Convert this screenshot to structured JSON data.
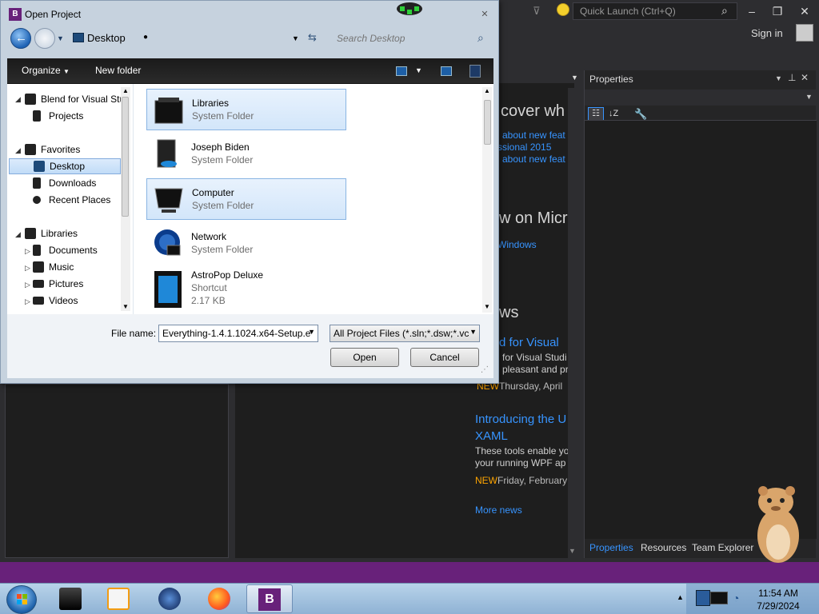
{
  "ide": {
    "quick_launch_placeholder": "Quick Launch (Ctrl+Q)",
    "sign_in": "Sign in",
    "start_page": {
      "heading_discover": "cover wh",
      "link1": "about new feat",
      "link2": "ssional 2015",
      "link3": "about new feat",
      "heading_new_on": "w on Micro",
      "windows_link": "Windows",
      "heading_news": "ws",
      "news1_title": "d for Visual",
      "news1_line1": "for Visual Studi",
      "news1_line2": "pleasant and pr",
      "news1_new": "NEW",
      "news1_date": "Thursday, April",
      "news2_title1": "Introducing the U",
      "news2_title2": "XAML",
      "news2_body1": "These tools enable yo",
      "news2_body2": "your running WPF ap",
      "news2_new": "NEW",
      "news2_date": "Friday, February",
      "more_news": "More news"
    },
    "properties": {
      "title": "Properties",
      "tabs": [
        "Properties",
        "Resources",
        "Team Explorer"
      ]
    },
    "accent_color": "#68217a"
  },
  "dialog": {
    "title": "Open Project",
    "address": "Desktop",
    "search_placeholder": "Search Desktop",
    "commands": {
      "organize": "Organize",
      "new_folder": "New folder"
    },
    "nav_tree": [
      {
        "label": "Blend for Visual Stu",
        "level": 0,
        "expanded": true
      },
      {
        "label": "Projects",
        "level": 1
      },
      {
        "label": "Favorites",
        "level": 0,
        "expanded": true
      },
      {
        "label": "Desktop",
        "level": 1,
        "selected": true
      },
      {
        "label": "Downloads",
        "level": 1
      },
      {
        "label": "Recent Places",
        "level": 1
      },
      {
        "label": "Libraries",
        "level": 0,
        "expanded": true
      },
      {
        "label": "Documents",
        "level": 1
      },
      {
        "label": "Music",
        "level": 1
      },
      {
        "label": "Pictures",
        "level": 1
      },
      {
        "label": "Videos",
        "level": 1
      }
    ],
    "files": [
      {
        "name": "Libraries",
        "type": "System Folder",
        "selected": true
      },
      {
        "name": "Joseph Biden",
        "type": "System Folder"
      },
      {
        "name": "Computer",
        "type": "System Folder",
        "selected": true
      },
      {
        "name": "Network",
        "type": "System Folder"
      },
      {
        "name": "AstroPop Deluxe",
        "type": "Shortcut",
        "size": "2.17 KB"
      }
    ],
    "file_name_label": "File name:",
    "file_name_value": "Everything-1.4.1.1024.x64-Setup.e",
    "file_type": "All Project Files (*.sln;*.dsw;*.vc",
    "open_button": "Open",
    "cancel_button": "Cancel"
  },
  "taskbar": {
    "time": "11:54 AM",
    "date": "7/29/2024",
    "apps": [
      "explorer-icon",
      "media-player-icon",
      "globe-icon",
      "firefox-icon",
      "blend-icon"
    ]
  }
}
